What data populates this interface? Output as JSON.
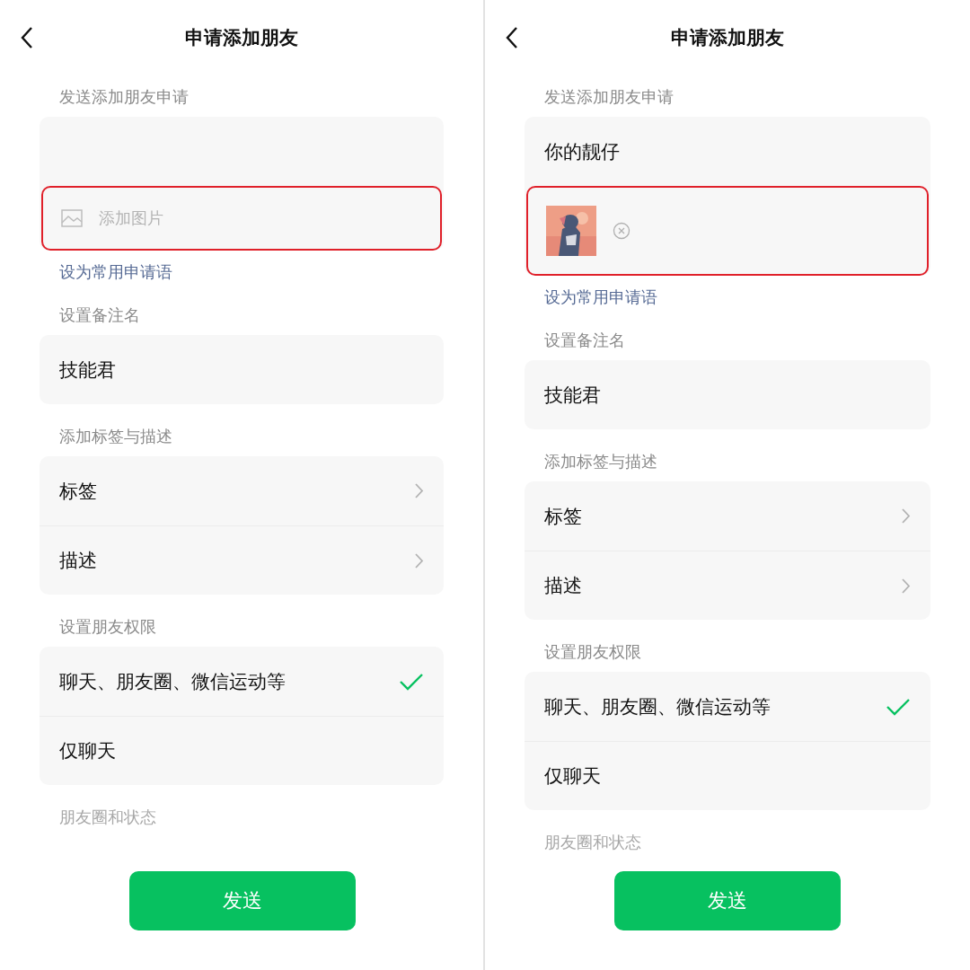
{
  "screens": [
    {
      "title": "申请添加朋友",
      "request": {
        "heading": "发送添加朋友申请",
        "image": {
          "kind": "placeholder",
          "label": "添加图片",
          "highlighted": true
        },
        "link": "设为常用申请语"
      },
      "remark": {
        "heading": "设置备注名",
        "value": "技能君"
      },
      "tags": {
        "heading": "添加标签与描述",
        "rows": [
          "标签",
          "描述"
        ]
      },
      "permissions": {
        "heading": "设置朋友权限",
        "options": [
          {
            "label": "聊天、朋友圈、微信运动等",
            "selected": true
          },
          {
            "label": "仅聊天",
            "selected": false
          }
        ]
      },
      "moments": {
        "heading": "朋友圈和状态"
      },
      "send_button": "发送"
    },
    {
      "title": "申请添加朋友",
      "request": {
        "heading": "发送添加朋友申请",
        "message": "你的靓仔",
        "image": {
          "kind": "picture",
          "highlighted": true
        },
        "link": "设为常用申请语"
      },
      "remark": {
        "heading": "设置备注名",
        "value": "技能君"
      },
      "tags": {
        "heading": "添加标签与描述",
        "rows": [
          "标签",
          "描述"
        ]
      },
      "permissions": {
        "heading": "设置朋友权限",
        "options": [
          {
            "label": "聊天、朋友圈、微信运动等",
            "selected": true
          },
          {
            "label": "仅聊天",
            "selected": false
          }
        ]
      },
      "moments": {
        "heading": "朋友圈和状态"
      },
      "send_button": "发送"
    }
  ]
}
